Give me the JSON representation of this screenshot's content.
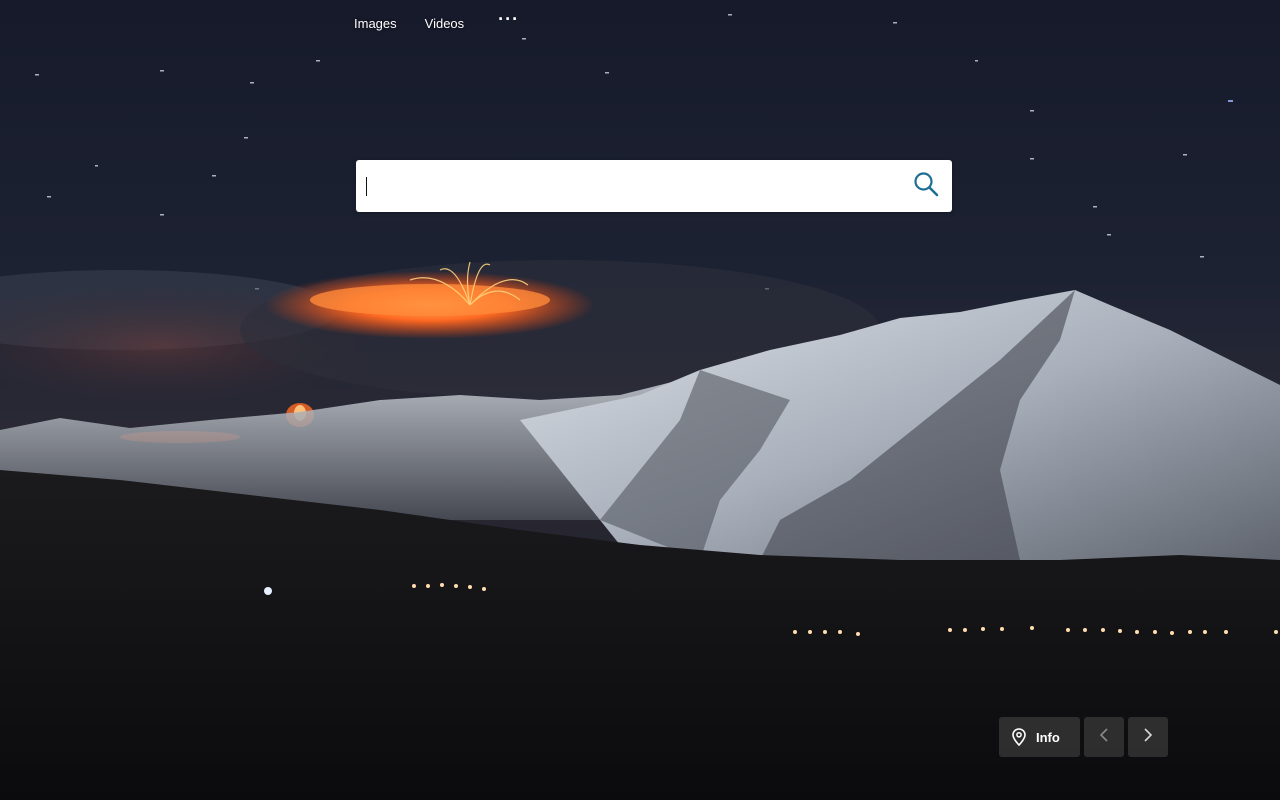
{
  "nav": {
    "links": [
      "Images",
      "Videos"
    ],
    "more_label": "···"
  },
  "search": {
    "value": "",
    "placeholder": ""
  },
  "controls": {
    "info_label": "Info",
    "icons": {
      "search": "search-icon",
      "location": "map-pin-icon",
      "previous": "chevron-left-icon",
      "next": "chevron-right-icon"
    }
  },
  "colors": {
    "search_icon": "#1f6f95",
    "control_bg": "#343434",
    "lava": "#ff5a1f"
  }
}
